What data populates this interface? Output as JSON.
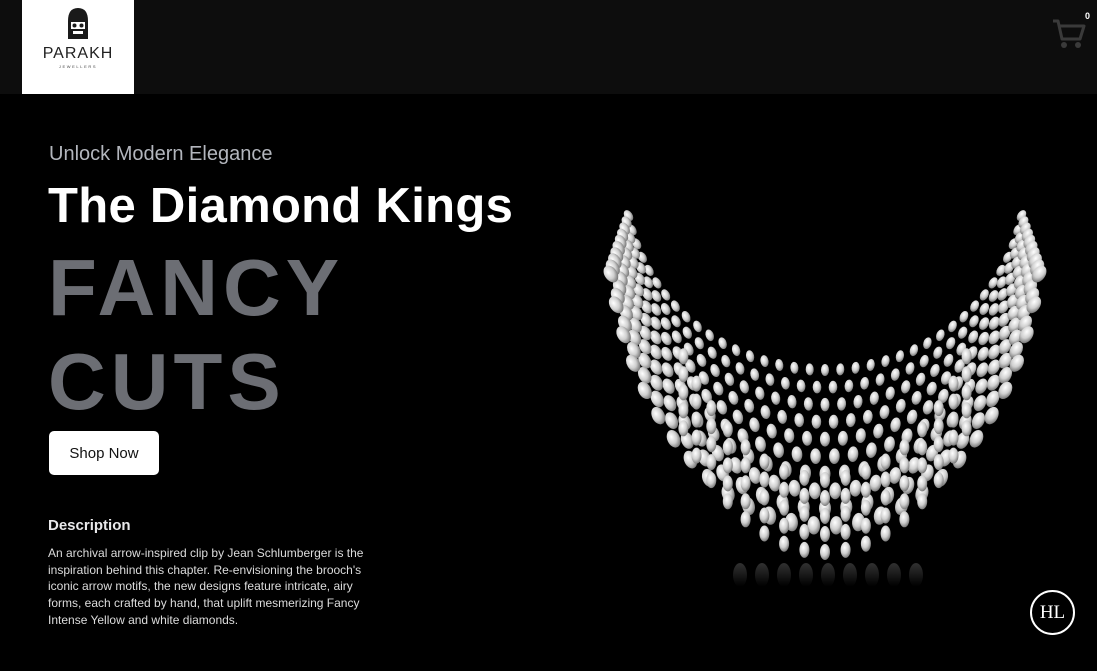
{
  "header": {
    "logo": {
      "name": "PARAKH",
      "sub": "JEWELLERS"
    },
    "cart": {
      "count": "0"
    }
  },
  "hero": {
    "eyebrow": "Unlock Modern Elegance",
    "headline": "The Diamond Kings",
    "big_line1": "FANCY",
    "big_line2": "CUTS",
    "shop_label": "Shop Now"
  },
  "description": {
    "title": "Description",
    "text": "An archival arrow-inspired clip by Jean Schlumberger is the inspiration behind this chapter. Re-envisioning the brooch's iconic arrow motifs, the new designs feature intricate, airy forms, each crafted by hand, that uplift mesmerizing Fancy Intense Yellow and white diamonds."
  },
  "floating": {
    "label": "HL"
  },
  "icons": [
    "logo-icon",
    "cart-icon",
    "hl-badge-icon"
  ],
  "colors": {
    "background": "#000000",
    "big_text": "#6c6e74",
    "eyebrow": "#b3b6bd"
  }
}
